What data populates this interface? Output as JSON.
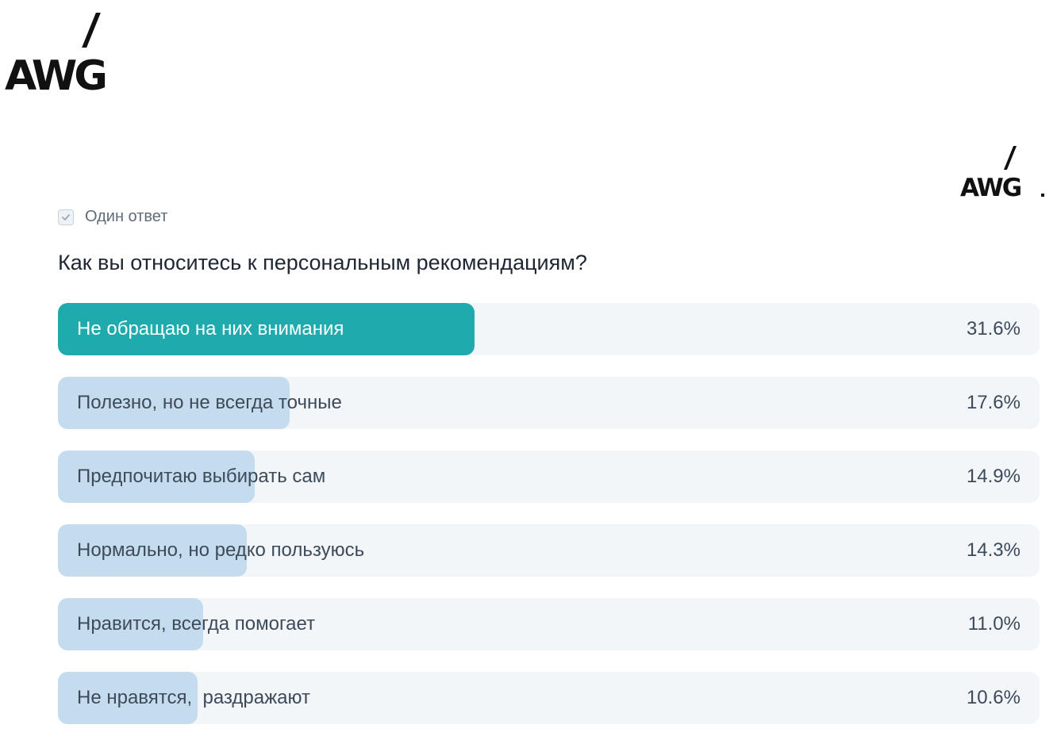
{
  "logos": {
    "top_left": "AWG",
    "top_right": "AWG"
  },
  "poll": {
    "answer_type": "Один ответ",
    "question": "Как вы относитесь к персональным рекомендациям?",
    "options": [
      {
        "label": "Не обращаю на них внимания",
        "percent": "31.6%",
        "value": 31.6
      },
      {
        "label": "Полезно, но не всегда точные",
        "percent": "17.6%",
        "value": 17.6
      },
      {
        "label": "Предпочитаю выбирать сам",
        "percent": "14.9%",
        "value": 14.9
      },
      {
        "label": "Нормально, но редко пользуюсь",
        "percent": "14.3%",
        "value": 14.3
      },
      {
        "label": "Нравится, всегда помогает",
        "percent": "11.0%",
        "value": 11.0
      },
      {
        "label": "Не нравятся,  раздражают",
        "percent": "10.6%",
        "value": 10.6
      }
    ]
  },
  "colors": {
    "leading_fill": "#1faaad",
    "other_fill": "#c5dcef",
    "track": "#f3f6f9"
  }
}
